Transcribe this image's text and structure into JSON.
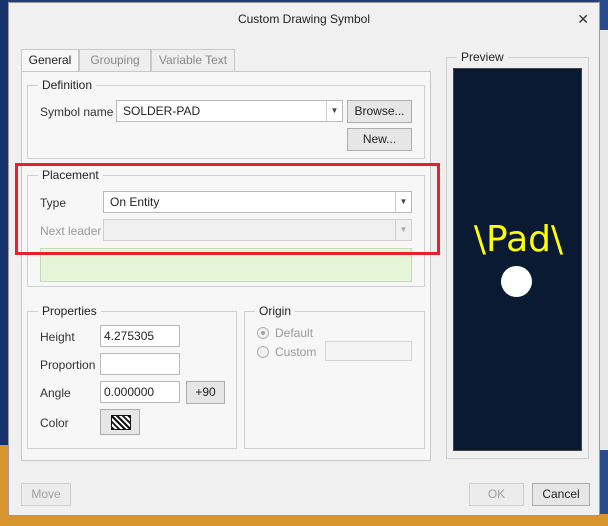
{
  "dialog": {
    "title": "Custom Drawing Symbol",
    "close_glyph": "✕"
  },
  "tabs": [
    {
      "label": "General",
      "active": true
    },
    {
      "label": "Grouping",
      "active": false
    },
    {
      "label": "Variable Text",
      "active": false
    }
  ],
  "definition": {
    "group_label": "Definition",
    "symbol_name_label": "Symbol name",
    "symbol_name_value": "SOLDER-PAD",
    "browse_label": "Browse...",
    "new_label": "New..."
  },
  "placement": {
    "group_label": "Placement",
    "type_label": "Type",
    "type_value": "On Entity",
    "next_leader_label": "Next leader",
    "next_leader_value": ""
  },
  "properties": {
    "group_label": "Properties",
    "height_label": "Height",
    "height_value": "4.275305",
    "proportion_label": "Proportion",
    "proportion_value": "",
    "angle_label": "Angle",
    "angle_value": "0.000000",
    "plus90_label": "+90",
    "color_label": "Color"
  },
  "origin": {
    "group_label": "Origin",
    "default_label": "Default",
    "custom_label": "Custom",
    "custom_value": ""
  },
  "preview": {
    "group_label": "Preview",
    "symbol_text": "\\Pad\\"
  },
  "footer": {
    "move_label": "Move",
    "ok_label": "OK",
    "cancel_label": "Cancel"
  },
  "colors": {
    "highlight": "#e8202a",
    "preview_bg": "#0a1a33",
    "preview_text": "#ffff00",
    "status_bar": "#e6f5d8"
  }
}
